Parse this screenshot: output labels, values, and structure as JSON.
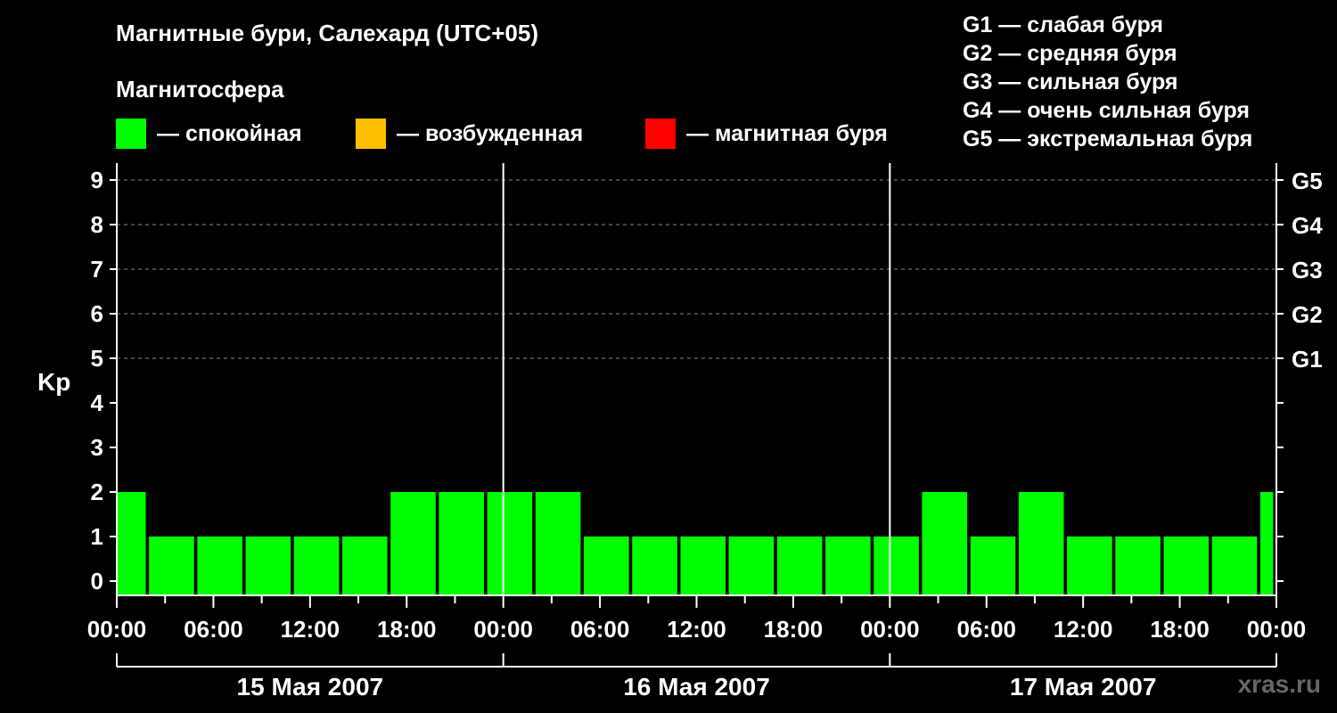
{
  "title": "Магнитные бури, Салехард (UTC+05)",
  "subtitle": "Магнитосфера",
  "legend": [
    {
      "label": "— спокойная",
      "color": "#00ff00"
    },
    {
      "label": "— возбужденная",
      "color": "#ffbf00"
    },
    {
      "label": "— магнитная буря",
      "color": "#ff0000"
    }
  ],
  "storm_legend": [
    "G1 — слабая буря",
    "G2 — средняя буря",
    "G3 — сильная буря",
    "G4 — очень сильная буря",
    "G5 — экстремальная буря"
  ],
  "watermark": "xras.ru",
  "chart_data": {
    "type": "bar",
    "ylabel": "Kp",
    "ylim": [
      0,
      9
    ],
    "yticks": [
      "0",
      "1",
      "2",
      "3",
      "4",
      "5",
      "6",
      "7",
      "8",
      "9"
    ],
    "right_ticks": [
      {
        "y": 5,
        "label": "G1"
      },
      {
        "y": 6,
        "label": "G2"
      },
      {
        "y": 7,
        "label": "G3"
      },
      {
        "y": 8,
        "label": "G4"
      },
      {
        "y": 9,
        "label": "G5"
      }
    ],
    "x_unit": "hours",
    "xlim": [
      0,
      72
    ],
    "x_tick_labels": [
      "00:00",
      "06:00",
      "12:00",
      "18:00",
      "00:00",
      "06:00",
      "12:00",
      "18:00",
      "00:00",
      "06:00",
      "12:00",
      "18:00",
      "00:00"
    ],
    "days": [
      "15 Мая 2007",
      "16 Мая 2007",
      "17 Мая 2007"
    ],
    "grid": "horizontal dashed",
    "bars": [
      {
        "start": 0,
        "end": 1.8,
        "kp": 2,
        "color": "#00ff00"
      },
      {
        "start": 2,
        "end": 4.8,
        "kp": 1,
        "color": "#00ff00"
      },
      {
        "start": 5,
        "end": 7.8,
        "kp": 1,
        "color": "#00ff00"
      },
      {
        "start": 8,
        "end": 10.8,
        "kp": 1,
        "color": "#00ff00"
      },
      {
        "start": 11,
        "end": 13.8,
        "kp": 1,
        "color": "#00ff00"
      },
      {
        "start": 14,
        "end": 16.8,
        "kp": 1,
        "color": "#00ff00"
      },
      {
        "start": 17,
        "end": 19.8,
        "kp": 2,
        "color": "#00ff00"
      },
      {
        "start": 20,
        "end": 22.8,
        "kp": 2,
        "color": "#00ff00"
      },
      {
        "start": 23,
        "end": 25.8,
        "kp": 2,
        "color": "#00ff00"
      },
      {
        "start": 26,
        "end": 28.8,
        "kp": 2,
        "color": "#00ff00"
      },
      {
        "start": 29,
        "end": 31.8,
        "kp": 1,
        "color": "#00ff00"
      },
      {
        "start": 32,
        "end": 34.8,
        "kp": 1,
        "color": "#00ff00"
      },
      {
        "start": 35,
        "end": 37.8,
        "kp": 1,
        "color": "#00ff00"
      },
      {
        "start": 38,
        "end": 40.8,
        "kp": 1,
        "color": "#00ff00"
      },
      {
        "start": 41,
        "end": 43.8,
        "kp": 1,
        "color": "#00ff00"
      },
      {
        "start": 44,
        "end": 46.8,
        "kp": 1,
        "color": "#00ff00"
      },
      {
        "start": 47,
        "end": 49.8,
        "kp": 1,
        "color": "#00ff00"
      },
      {
        "start": 50,
        "end": 52.8,
        "kp": 2,
        "color": "#00ff00"
      },
      {
        "start": 53,
        "end": 55.8,
        "kp": 1,
        "color": "#00ff00"
      },
      {
        "start": 56,
        "end": 58.8,
        "kp": 2,
        "color": "#00ff00"
      },
      {
        "start": 59,
        "end": 61.8,
        "kp": 1,
        "color": "#00ff00"
      },
      {
        "start": 62,
        "end": 64.8,
        "kp": 1,
        "color": "#00ff00"
      },
      {
        "start": 65,
        "end": 67.8,
        "kp": 1,
        "color": "#00ff00"
      },
      {
        "start": 68,
        "end": 70.8,
        "kp": 1,
        "color": "#00ff00"
      },
      {
        "start": 71,
        "end": 71.8,
        "kp": 2,
        "color": "#00ff00"
      }
    ]
  }
}
